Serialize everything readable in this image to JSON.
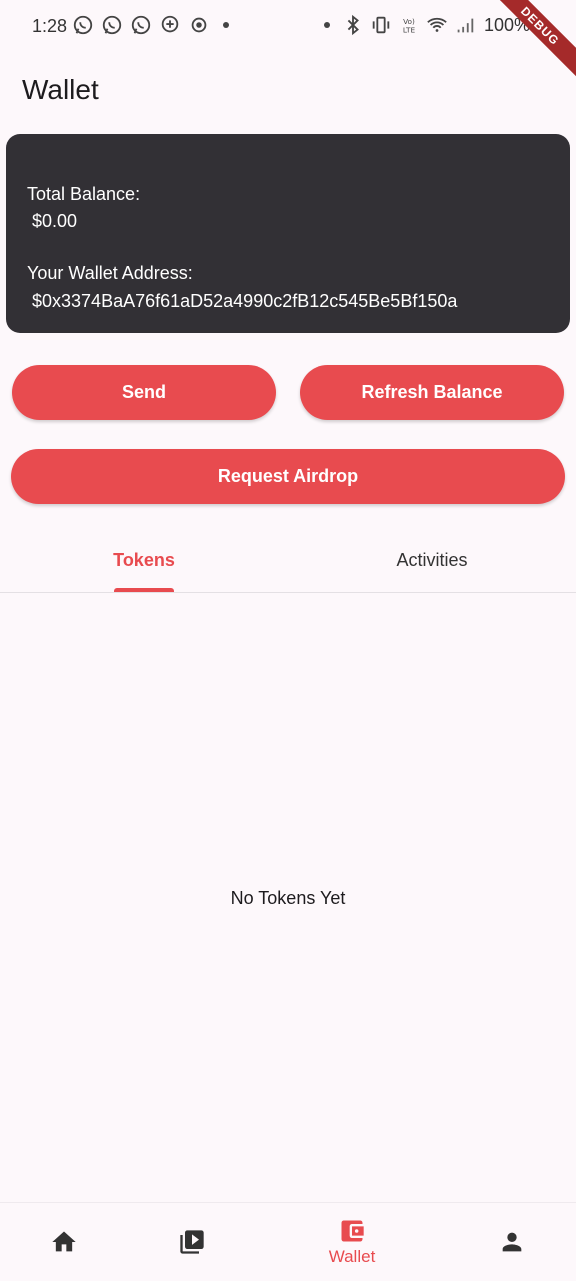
{
  "status_bar": {
    "time": "1:28",
    "battery": "100%",
    "debug_banner": "DEBUG"
  },
  "header": {
    "title": "Wallet"
  },
  "balance_card": {
    "total_balance_label": "Total Balance:",
    "total_balance_value": "$0.00",
    "address_label": "Your Wallet Address:",
    "address_value": "$0x3374BaA76f61aD52a4990c2fB12c545Be5Bf150a"
  },
  "actions": {
    "send_label": "Send",
    "refresh_label": "Refresh Balance",
    "airdrop_label": "Request Airdrop"
  },
  "tabs": [
    {
      "label": "Tokens",
      "selected": true
    },
    {
      "label": "Activities",
      "selected": false
    }
  ],
  "empty_state": {
    "message": "No Tokens Yet"
  },
  "bottom_nav": {
    "items": [
      {
        "icon": "home-icon",
        "label": ""
      },
      {
        "icon": "video-library-icon",
        "label": ""
      },
      {
        "icon": "wallet-icon",
        "label": "Wallet",
        "selected": true
      },
      {
        "icon": "person-icon",
        "label": ""
      }
    ]
  },
  "colors": {
    "accent": "#e84b4f",
    "card_bg": "#323035",
    "background": "#fdf8fb"
  }
}
